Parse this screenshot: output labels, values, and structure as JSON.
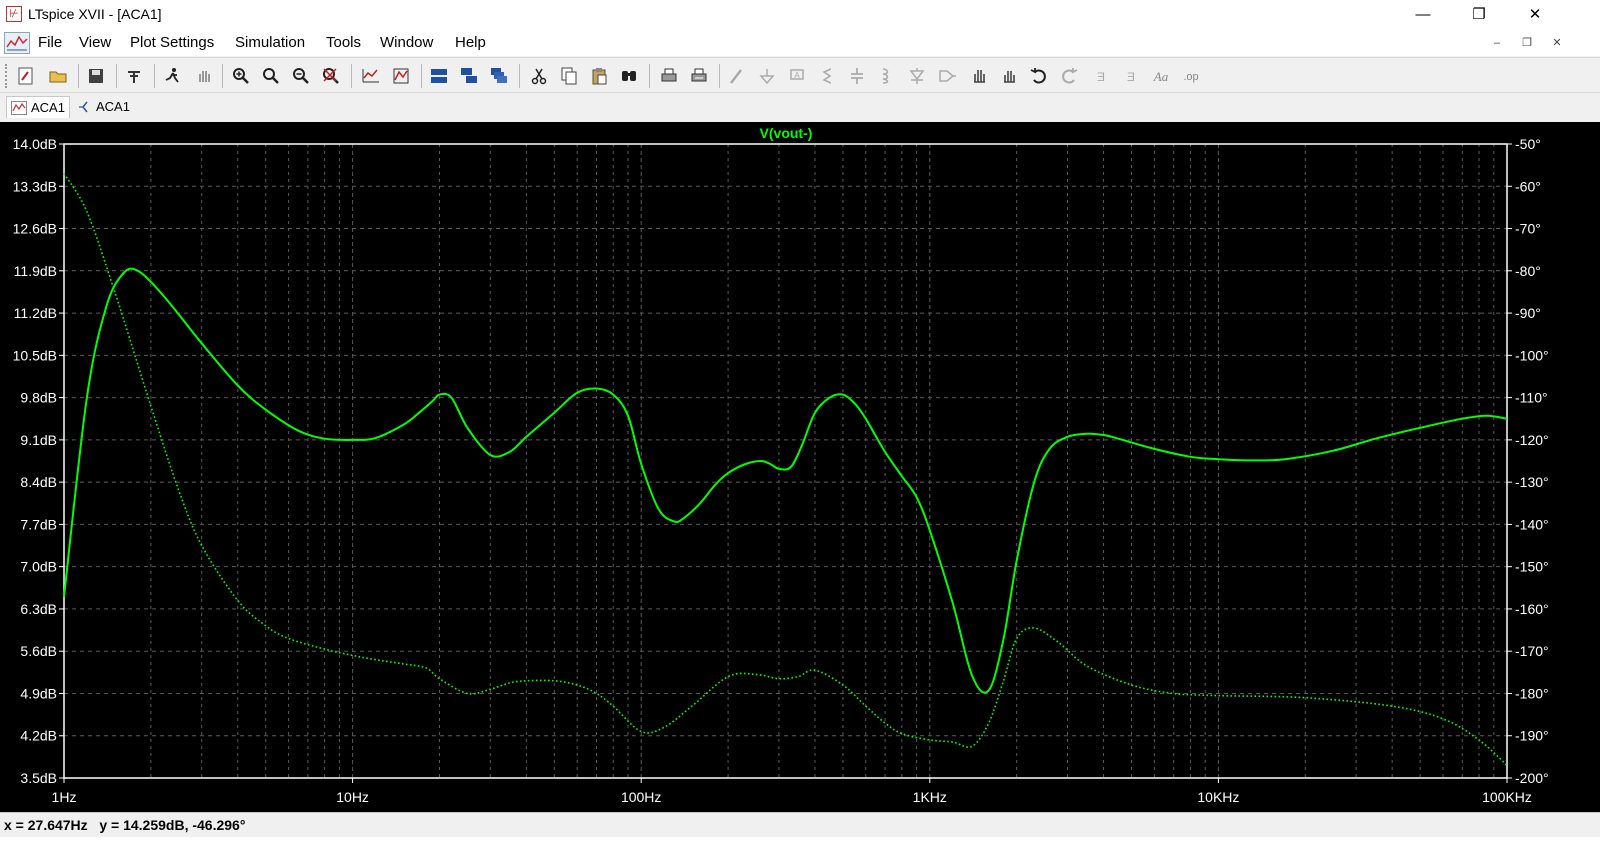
{
  "window": {
    "title": "LTspice XVII - [ACA1]"
  },
  "menu": {
    "items": [
      "File",
      "View",
      "Plot Settings",
      "Simulation",
      "Tools",
      "Window",
      "Help"
    ]
  },
  "tabs": [
    {
      "label": "ACA1",
      "kind": "waveform",
      "active": true
    },
    {
      "label": "ACA1",
      "kind": "schematic",
      "active": false
    }
  ],
  "toolbar_icons": [
    "new-schematic-icon",
    "open-icon",
    "save-icon",
    "control-panel-icon",
    "run-icon",
    "pause-hand-icon",
    "zoom-in-icon",
    "zoom-area-icon",
    "zoom-out-icon",
    "zoom-fit-icon",
    "autorange-icon",
    "mark-icon",
    "tile-horizontal-icon",
    "tile-vertical-icon",
    "cascade-icon",
    "cut-icon",
    "copy-icon",
    "paste-icon",
    "find-icon",
    "print-icon",
    "print-setup-icon",
    "wire-icon",
    "ground-icon",
    "label-icon",
    "resistor-icon",
    "capacitor-icon",
    "inductor-icon",
    "diode-icon",
    "component-icon",
    "move-icon",
    "drag-icon",
    "undo-icon",
    "redo-icon",
    "rotate-icon",
    "mirror-icon",
    "text-icon",
    "spice-directive-icon"
  ],
  "colors": {
    "trace": "#00ff00",
    "plot_bg": "#000000",
    "grid": "#5a5a5a",
    "axis_text": "#ffffff"
  },
  "chart_data": {
    "type": "line",
    "title": "V(vout-)",
    "x_scale": "log",
    "xlim": [
      1,
      100000
    ],
    "x_ticks": [
      "1Hz",
      "10Hz",
      "100Hz",
      "1KHz",
      "10KHz",
      "100KHz"
    ],
    "ylim_left": [
      3.5,
      14.0
    ],
    "y_ticks_left": [
      "14.0dB",
      "13.3dB",
      "12.6dB",
      "11.9dB",
      "11.2dB",
      "10.5dB",
      "9.8dB",
      "9.1dB",
      "8.4dB",
      "7.7dB",
      "7.0dB",
      "6.3dB",
      "5.6dB",
      "4.9dB",
      "4.2dB",
      "3.5dB"
    ],
    "ylim_right": [
      -200,
      -50
    ],
    "y_ticks_right": [
      "-50°",
      "-60°",
      "-70°",
      "-80°",
      "-90°",
      "-100°",
      "-110°",
      "-120°",
      "-130°",
      "-140°",
      "-150°",
      "-160°",
      "-170°",
      "-180°",
      "-190°",
      "-200°"
    ],
    "grid": true,
    "series": [
      {
        "name": "V(vout-)",
        "axis": "left",
        "style": "solid",
        "x": [
          1,
          1.2,
          1.4,
          1.6,
          1.8,
          2.2,
          3,
          4,
          5,
          6.5,
          8,
          10,
          12,
          15,
          17,
          19,
          20,
          22,
          25,
          30,
          35,
          40,
          50,
          60,
          70,
          80,
          90,
          100,
          115,
          130,
          140,
          160,
          180,
          200,
          230,
          260,
          280,
          300,
          330,
          360,
          400,
          450,
          500,
          550,
          600,
          700,
          800,
          900,
          1000,
          1200,
          1400,
          1600,
          1800,
          2000,
          2300,
          2600,
          3000,
          3500,
          4000,
          4500,
          6000,
          8000,
          10000,
          13000,
          17000,
          25000,
          35000,
          50000,
          70000,
          85000,
          100000
        ],
        "y": [
          6.5,
          9.8,
          11.3,
          11.85,
          11.9,
          11.5,
          10.7,
          10.0,
          9.6,
          9.25,
          9.12,
          9.1,
          9.13,
          9.35,
          9.55,
          9.75,
          9.85,
          9.8,
          9.3,
          8.85,
          8.9,
          9.15,
          9.55,
          9.88,
          9.95,
          9.85,
          9.5,
          8.7,
          7.95,
          7.75,
          7.8,
          8.05,
          8.35,
          8.55,
          8.7,
          8.75,
          8.7,
          8.62,
          8.65,
          9.0,
          9.55,
          9.8,
          9.85,
          9.7,
          9.45,
          8.9,
          8.5,
          8.15,
          7.6,
          6.4,
          5.2,
          4.95,
          5.8,
          7.1,
          8.4,
          8.95,
          9.15,
          9.2,
          9.18,
          9.12,
          8.95,
          8.82,
          8.78,
          8.76,
          8.78,
          8.92,
          9.12,
          9.3,
          9.45,
          9.5,
          9.45
        ]
      },
      {
        "name": "phase",
        "axis": "right",
        "style": "dotted",
        "x": [
          1,
          1.2,
          1.5,
          2,
          2.5,
          3,
          4,
          5,
          6,
          8,
          10,
          12,
          15,
          18,
          20,
          25,
          30,
          35,
          40,
          50,
          60,
          70,
          80,
          100,
          120,
          150,
          200,
          250,
          300,
          350,
          400,
          500,
          600,
          700,
          800,
          1000,
          1200,
          1400,
          1600,
          1800,
          2000,
          2300,
          2800,
          3500,
          5000,
          7000,
          10000,
          20000,
          40000,
          60000,
          80000,
          100000
        ],
        "y": [
          -57,
          -66,
          -85,
          -112,
          -132,
          -145,
          -158,
          -164,
          -167,
          -169.5,
          -171,
          -172,
          -173,
          -174,
          -176.5,
          -180,
          -179,
          -177.5,
          -177,
          -177,
          -178,
          -180,
          -183,
          -189,
          -188,
          -183,
          -176,
          -175.5,
          -176.5,
          -176,
          -174.5,
          -178,
          -183,
          -187,
          -189.5,
          -191,
          -191.5,
          -192.5,
          -187,
          -177,
          -167,
          -164.5,
          -168,
          -173.5,
          -178,
          -180,
          -180.5,
          -181,
          -183,
          -186,
          -191,
          -197
        ]
      }
    ]
  },
  "status": {
    "x_label": "x = 27.647Hz",
    "y_label": "y = 14.259dB, -46.296°"
  }
}
